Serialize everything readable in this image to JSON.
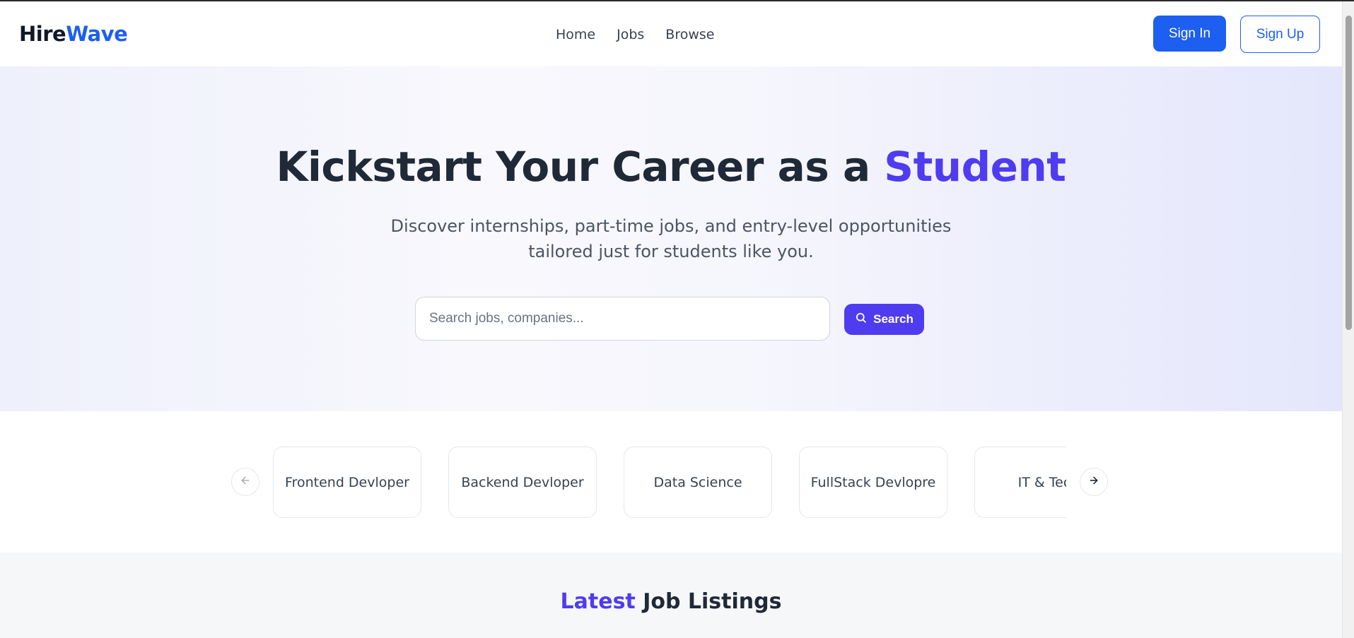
{
  "brand": {
    "part1": "Hire",
    "part2": "Wave"
  },
  "nav": {
    "links": [
      "Home",
      "Jobs",
      "Browse"
    ]
  },
  "auth": {
    "sign_in": "Sign In",
    "sign_up": "Sign Up"
  },
  "hero": {
    "title_main": "Kickstart Your Career as a ",
    "title_accent": "Student",
    "subtitle": "Discover internships, part-time jobs, and entry-level opportunities tailored just for students like you."
  },
  "search": {
    "placeholder": "Search jobs, companies...",
    "value": "",
    "button_label": "Search"
  },
  "categories": {
    "items": [
      "Frontend Devloper",
      "Backend Devloper",
      "Data Science",
      "FullStack Devlopre",
      "IT & Tech"
    ],
    "prev_icon": "arrow-left-icon",
    "next_icon": "arrow-right-icon"
  },
  "latest": {
    "accent": "Latest",
    "rest": " Job Listings"
  },
  "colors": {
    "brand_blue": "#1d5ff0",
    "accent_purple": "#4f3cf0"
  }
}
